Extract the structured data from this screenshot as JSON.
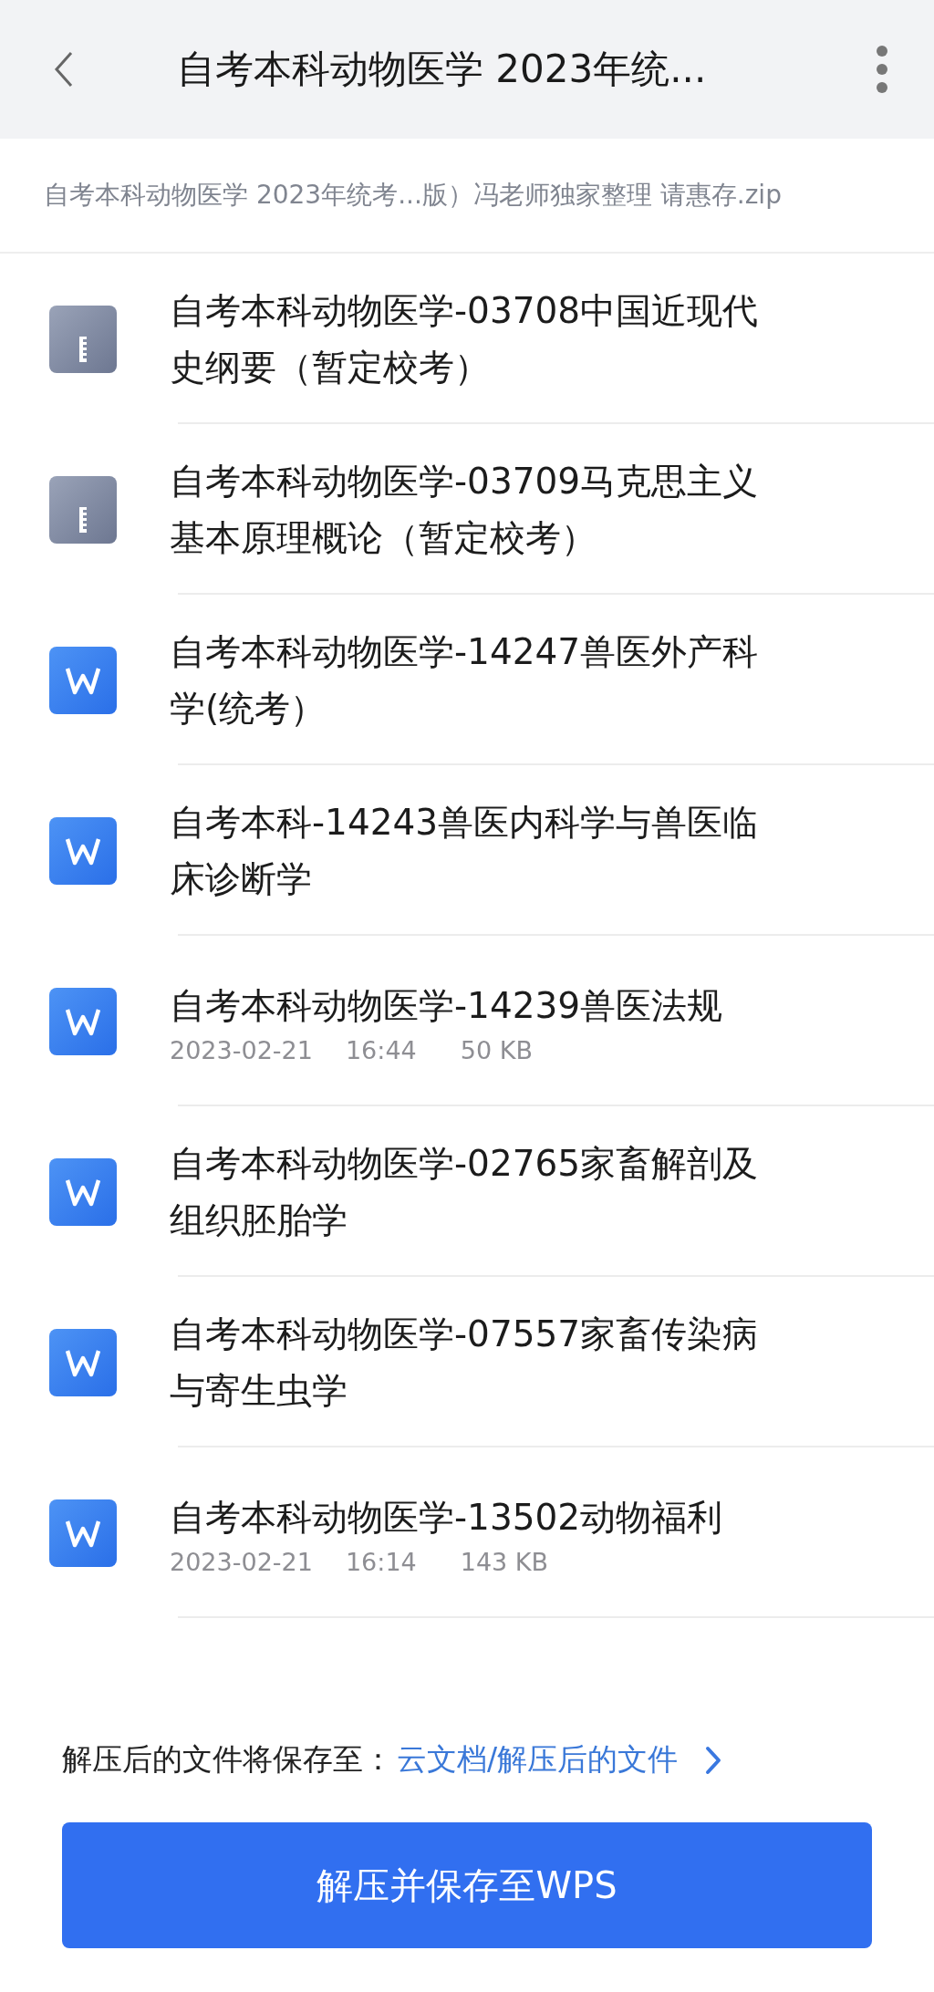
{
  "header": {
    "title": "自考本科动物医学 2023年统..."
  },
  "path": "自考本科动物医学 2023年统考...版）冯老师独家整理 请惠存.zip",
  "files": [
    {
      "kind": "zip",
      "lines": [
        "自考本科动物医学-03708中国近现代",
        "史纲要（暂定校考）"
      ]
    },
    {
      "kind": "zip",
      "lines": [
        "自考本科动物医学-03709马克思主义",
        "基本原理概论（暂定校考）"
      ]
    },
    {
      "kind": "word",
      "lines": [
        "自考本科动物医学-14247兽医外产科",
        "学(统考）"
      ]
    },
    {
      "kind": "word",
      "lines": [
        "自考本科-14243兽医内科学与兽医临",
        "床诊断学"
      ]
    },
    {
      "kind": "word",
      "lines": [
        "自考本科动物医学-14239兽医法规"
      ],
      "date": "2023-02-21",
      "time": "16:44",
      "size": "50 KB"
    },
    {
      "kind": "word",
      "lines": [
        "自考本科动物医学-02765家畜解剖及",
        "组织胚胎学"
      ]
    },
    {
      "kind": "word",
      "lines": [
        "自考本科动物医学-07557家畜传染病",
        "与寄生虫学"
      ]
    },
    {
      "kind": "word",
      "lines": [
        "自考本科动物医学-13502动物福利"
      ],
      "date": "2023-02-21",
      "time": "16:14",
      "size": "143 KB"
    }
  ],
  "save_to": {
    "label": "解压后的文件将保存至：",
    "link": "云文档/解压后的文件"
  },
  "button": "解压并保存至WPS"
}
